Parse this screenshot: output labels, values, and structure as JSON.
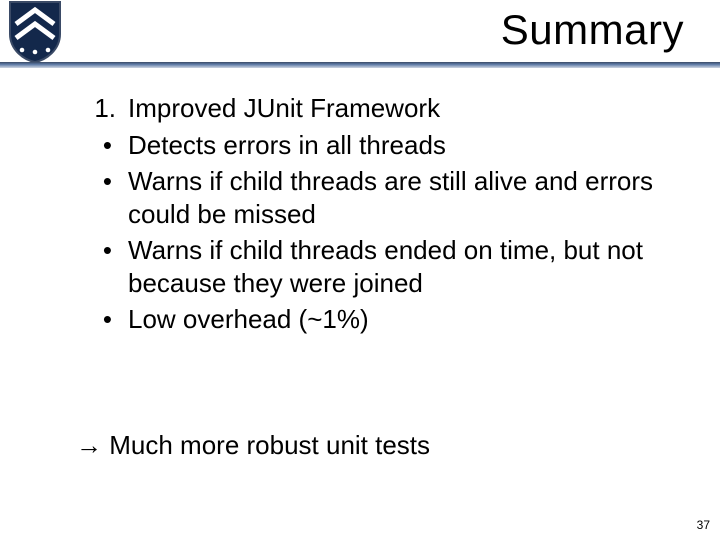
{
  "title": "Summary",
  "list": {
    "num_marker": "1.",
    "heading": "Improved JUnit Framework",
    "bullet_marker": "•",
    "items": [
      "Detects errors in all threads",
      "Warns if child threads are still alive and errors could be missed",
      "Warns if child threads ended on time, but not because they were joined",
      "Low overhead (~1%)"
    ]
  },
  "conclusion": {
    "arrow": "→",
    "text": "Much more robust unit tests"
  },
  "page_number": "37",
  "shield": {
    "bg": "#13284b",
    "chev": "#ffffff",
    "star": "#ffffff",
    "border": "#3a4a66"
  }
}
